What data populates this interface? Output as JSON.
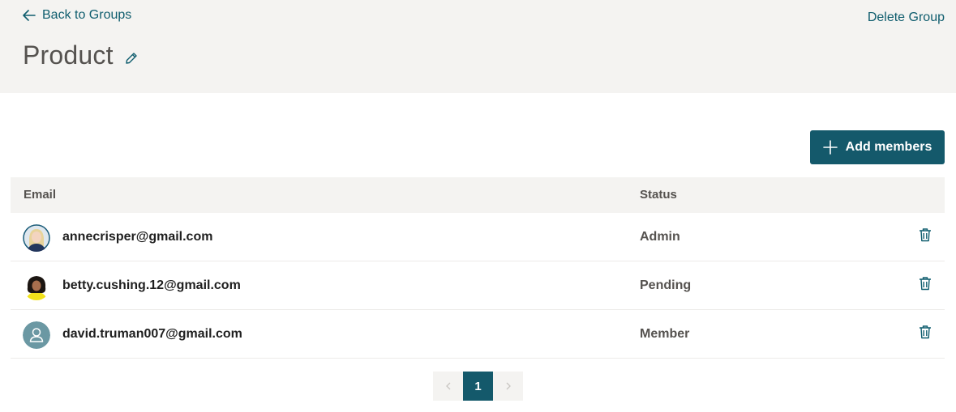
{
  "header": {
    "back_label": "Back to Groups",
    "delete_label": "Delete Group",
    "title": "Product"
  },
  "toolbar": {
    "add_members_label": "Add members"
  },
  "table": {
    "columns": {
      "email": "Email",
      "status": "Status"
    },
    "rows": [
      {
        "email": "annecrisper@gmail.com",
        "status": "Admin",
        "avatar": "photo-blonde-woman"
      },
      {
        "email": "betty.cushing.12@gmail.com",
        "status": "Pending",
        "avatar": "photo-curly-hair-woman"
      },
      {
        "email": "david.truman007@gmail.com",
        "status": "Member",
        "avatar": "default-person-icon"
      }
    ]
  },
  "pagination": {
    "current_page": "1",
    "prev_icon": "chevron-left-icon",
    "next_icon": "chevron-right-icon"
  },
  "colors": {
    "accent": "#14596b",
    "link": "#0f5d6e",
    "header_bg": "#f4f3f1"
  }
}
